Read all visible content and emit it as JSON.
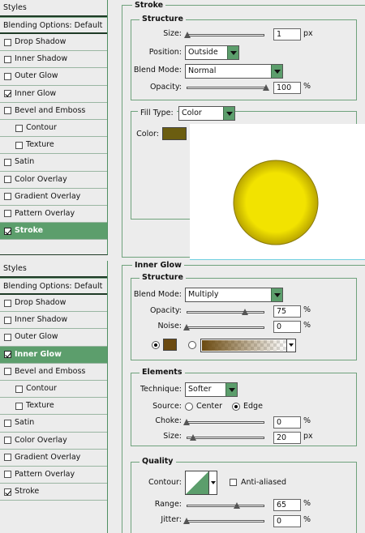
{
  "panel1": {
    "title": "Styles",
    "blending": "Blending Options: Default",
    "items": [
      {
        "label": "Drop Shadow",
        "checked": false
      },
      {
        "label": "Inner Shadow",
        "checked": false
      },
      {
        "label": "Outer Glow",
        "checked": false
      },
      {
        "label": "Inner Glow",
        "checked": true
      },
      {
        "label": "Bevel and Emboss",
        "checked": false
      },
      {
        "label": "Contour",
        "checked": false
      },
      {
        "label": "Texture",
        "checked": false
      },
      {
        "label": "Satin",
        "checked": false
      },
      {
        "label": "Color Overlay",
        "checked": false
      },
      {
        "label": "Gradient Overlay",
        "checked": false
      },
      {
        "label": "Pattern Overlay",
        "checked": false
      },
      {
        "label": "Stroke",
        "checked": true,
        "active": true
      }
    ]
  },
  "panel2": {
    "title": "Styles",
    "blending": "Blending Options: Default",
    "items": [
      {
        "label": "Drop Shadow",
        "checked": false
      },
      {
        "label": "Inner Shadow",
        "checked": false
      },
      {
        "label": "Outer Glow",
        "checked": false
      },
      {
        "label": "Inner Glow",
        "checked": true,
        "active": true
      },
      {
        "label": "Bevel and Emboss",
        "checked": false
      },
      {
        "label": "Contour",
        "checked": false
      },
      {
        "label": "Texture",
        "checked": false
      },
      {
        "label": "Satin",
        "checked": false
      },
      {
        "label": "Color Overlay",
        "checked": false
      },
      {
        "label": "Gradient Overlay",
        "checked": false
      },
      {
        "label": "Pattern Overlay",
        "checked": false
      },
      {
        "label": "Stroke",
        "checked": true
      }
    ]
  },
  "stroke": {
    "title": "Stroke",
    "structure_title": "Structure",
    "size_label": "Size:",
    "size_value": "1",
    "size_unit": "px",
    "size_level": 0.01,
    "position_label": "Position:",
    "position_value": "Outside",
    "blend_label": "Blend Mode:",
    "blend_value": "Normal",
    "opacity_label": "Opacity:",
    "opacity_value": "100",
    "opacity_unit": "%",
    "opacity_level": 1.0,
    "fill_label": "Fill Type:",
    "fill_value": "Color",
    "color_label": "Color:",
    "color": "#6b5d10"
  },
  "preview": {
    "circle_fill": "#f2e300",
    "circle_edge": "#8a7a08"
  },
  "inner_glow": {
    "title": "Inner Glow",
    "structure_title": "Structure",
    "blend_label": "Blend Mode:",
    "blend_value": "Multiply",
    "opacity_label": "Opacity:",
    "opacity_value": "75",
    "opacity_unit": "%",
    "opacity_level": 0.75,
    "noise_label": "Noise:",
    "noise_value": "0",
    "noise_unit": "%",
    "noise_level": 0.0,
    "glow_color": "#6b4a10",
    "elements_title": "Elements",
    "technique_label": "Technique:",
    "technique_value": "Softer",
    "source_label": "Source:",
    "source_center": "Center",
    "source_edge": "Edge",
    "choke_label": "Choke:",
    "choke_value": "0",
    "choke_unit": "%",
    "choke_level": 0.0,
    "size_label": "Size:",
    "size_value": "20",
    "size_unit": "px",
    "size_level": 0.08,
    "quality_title": "Quality",
    "contour_label": "Contour:",
    "antialiased_label": "Anti-aliased",
    "range_label": "Range:",
    "range_value": "65",
    "range_unit": "%",
    "range_level": 0.65,
    "jitter_label": "Jitter:",
    "jitter_value": "0",
    "jitter_unit": "%",
    "jitter_level": 0.0
  },
  "colors": {
    "accent": "#5c9e6c",
    "border": "#6fa27c"
  }
}
